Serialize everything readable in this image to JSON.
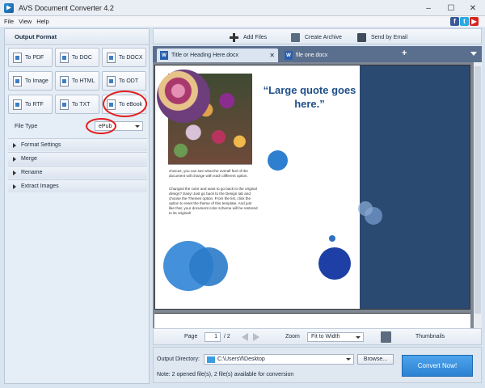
{
  "app": {
    "title": "AVS Document Converter 4.2"
  },
  "window_controls": {
    "minimize": "–",
    "maximize": "☐",
    "close": "✕"
  },
  "menu": [
    "File",
    "View",
    "Help"
  ],
  "social": {
    "facebook": "f",
    "twitter": "t",
    "youtube": "▶"
  },
  "left_panel": {
    "header": "Output Format",
    "formats": [
      "To PDF",
      "To DOC",
      "To DOCX",
      "To Image",
      "To HTML",
      "To ODT",
      "To RTF",
      "To TXT",
      "To eBook"
    ],
    "selected_format": "To eBook",
    "file_type_label": "File Type",
    "file_type_value": "ePub",
    "sections": [
      "Format Settings",
      "Merge",
      "Rename",
      "Extract Images"
    ]
  },
  "toolbar": {
    "add_files": "Add Files",
    "create_archive": "Create Archive",
    "send_email": "Send by Email"
  },
  "tabs": [
    {
      "label": "Title or Heading Here.docx",
      "close": "✕"
    },
    {
      "label": "file one.docx"
    }
  ],
  "tab_add": "+",
  "document": {
    "quote": "“Large quote goes here.”",
    "paragraph1": "choices, you can see what the overall feel of the document will change with each different option.",
    "paragraph2": "Changed the color and want to go back to the original design? Easy! Just go back to the Design tab and choose the Themes option. From the list, click the option to reset the theme of this template. And just like that, your document color scheme will be restored to its original!"
  },
  "navigation": {
    "page_label": "Page",
    "page_value": "1",
    "page_total": "/ 2",
    "zoom_label": "Zoom",
    "zoom_value": "Fit to Width",
    "thumbnails": "Thumbnails"
  },
  "output": {
    "directory_label": "Output Directory:",
    "directory_value": "C:\\Users\\f\\Desktop",
    "browse": "Browse...",
    "note": "Note: 2 opened file(s), 2 file(s) available for conversion",
    "convert": "Convert Now!"
  },
  "colors": {
    "accent": "#2c82d3",
    "sidebar_panel": "#2b4a72",
    "highlight_ring": "#e21d1d"
  }
}
